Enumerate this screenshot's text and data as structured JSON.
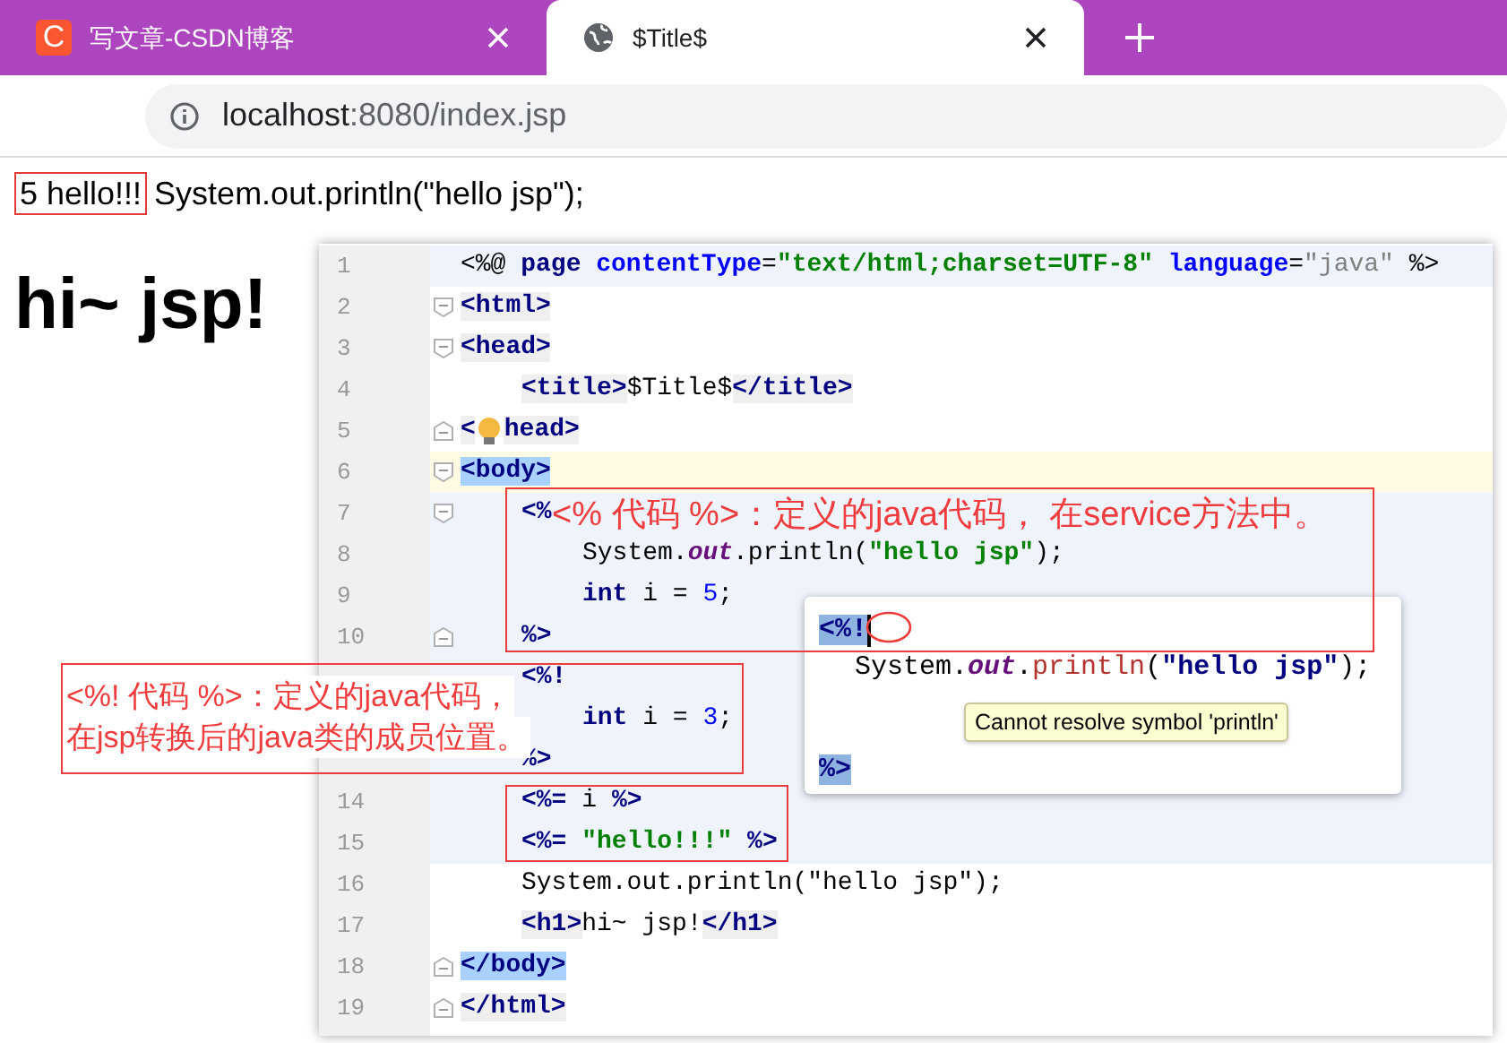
{
  "browser": {
    "tabs": [
      {
        "title": "写文章-CSDN博客",
        "logo_text": "C",
        "selected": false
      },
      {
        "title": "$Title$",
        "selected": true
      }
    ],
    "address": {
      "host": "localhost",
      "rest": ":8080/index.jsp"
    }
  },
  "page": {
    "boxed_output": "5 hello!!!",
    "output": "System.out.println(\"hello jsp\");",
    "heading": "hi~ jsp!"
  },
  "editor": {
    "lines": [
      {
        "number": "1",
        "scriptlet": true,
        "current": false,
        "indented": false,
        "nested": false,
        "fold_start": false,
        "fold_end": false,
        "tokens": [
          {
            "text": "<%@ ",
            "kind": "plain"
          },
          {
            "text": "page",
            "kind": "keyword"
          },
          {
            "text": " contentType",
            "kind": "attr"
          },
          {
            "text": "=",
            "kind": "plain"
          },
          {
            "text": "\"text/html;charset=UTF-8\"",
            "kind": "string"
          },
          {
            "text": " language",
            "kind": "attr"
          },
          {
            "text": "=",
            "kind": "plain"
          },
          {
            "text": "\"java\"",
            "kind": "string_gray"
          },
          {
            "text": " %>",
            "kind": "plain"
          }
        ]
      },
      {
        "number": "2",
        "scriptlet": false,
        "current": false,
        "indented": false,
        "nested": false,
        "fold_start": true,
        "fold_end": false,
        "tokens": [
          {
            "text": "<html>",
            "kind": "tag"
          }
        ]
      },
      {
        "number": "3",
        "scriptlet": false,
        "current": false,
        "indented": false,
        "nested": false,
        "fold_start": true,
        "fold_end": false,
        "tokens": [
          {
            "text": "<head>",
            "kind": "tag"
          }
        ]
      },
      {
        "number": "4",
        "scriptlet": false,
        "current": false,
        "indented": true,
        "nested": false,
        "fold_start": false,
        "fold_end": false,
        "tokens": [
          {
            "text": "<title>",
            "kind": "tag"
          },
          {
            "text": "$Title$",
            "kind": "plain"
          },
          {
            "text": "</title>",
            "kind": "tag"
          }
        ]
      },
      {
        "number": "5",
        "scriptlet": false,
        "current": false,
        "indented": false,
        "nested": false,
        "fold_start": false,
        "fold_end": true,
        "tokens": [
          {
            "text": "<",
            "kind": "tag"
          },
          {
            "kind": "bulb"
          },
          {
            "text": "head>",
            "kind": "tag"
          }
        ]
      },
      {
        "number": "6",
        "scriptlet": false,
        "current": true,
        "indented": false,
        "nested": false,
        "fold_start": true,
        "fold_end": false,
        "tokens": [
          {
            "text": "<body>",
            "kind": "tag_match"
          }
        ]
      },
      {
        "number": "7",
        "scriptlet": true,
        "current": false,
        "indented": true,
        "nested": false,
        "fold_start": true,
        "fold_end": false,
        "tokens": [
          {
            "text": "<%",
            "kind": "delim"
          }
        ]
      },
      {
        "number": "8",
        "scriptlet": true,
        "current": false,
        "indented": true,
        "nested": true,
        "fold_start": false,
        "fold_end": false,
        "tokens": [
          {
            "text": "System.",
            "kind": "plain"
          },
          {
            "text": "out",
            "kind": "field"
          },
          {
            "text": ".println(",
            "kind": "plain"
          },
          {
            "text": "\"hello jsp\"",
            "kind": "string"
          },
          {
            "text": ");",
            "kind": "plain"
          }
        ]
      },
      {
        "number": "9",
        "scriptlet": true,
        "current": false,
        "indented": true,
        "nested": true,
        "fold_start": false,
        "fold_end": false,
        "tokens": [
          {
            "text": "int",
            "kind": "keyword"
          },
          {
            "text": " i = ",
            "kind": "plain"
          },
          {
            "text": "5",
            "kind": "number"
          },
          {
            "text": ";",
            "kind": "plain"
          }
        ]
      },
      {
        "number": "10",
        "scriptlet": true,
        "current": false,
        "indented": true,
        "nested": false,
        "fold_start": false,
        "fold_end": true,
        "tokens": [
          {
            "text": "%>",
            "kind": "delim"
          }
        ]
      },
      {
        "scriptlet": true,
        "current": false,
        "indented": true,
        "nested": false,
        "tokens": [
          {
            "text": "<%!",
            "kind": "delim"
          }
        ]
      },
      {
        "scriptlet": true,
        "current": false,
        "indented": true,
        "nested": true,
        "tokens": [
          {
            "text": "int",
            "kind": "keyword"
          },
          {
            "text": " i = ",
            "kind": "plain"
          },
          {
            "text": "3",
            "kind": "number"
          },
          {
            "text": ";",
            "kind": "plain"
          }
        ]
      },
      {
        "scriptlet": true,
        "current": false,
        "indented": true,
        "nested": false,
        "tokens": [
          {
            "text": "%>",
            "kind": "delim"
          }
        ]
      },
      {
        "number": "14",
        "scriptlet": true,
        "current": false,
        "indented": true,
        "nested": false,
        "fold_start": false,
        "fold_end": false,
        "tokens": [
          {
            "text": "<%=",
            "kind": "delim"
          },
          {
            "text": " i ",
            "kind": "plain"
          },
          {
            "text": "%>",
            "kind": "delim"
          }
        ]
      },
      {
        "number": "15",
        "scriptlet": true,
        "current": false,
        "indented": true,
        "nested": false,
        "fold_start": false,
        "fold_end": false,
        "tokens": [
          {
            "text": "<%=",
            "kind": "delim"
          },
          {
            "text": " \"hello!!!\"",
            "kind": "string"
          },
          {
            "text": " %>",
            "kind": "delim"
          }
        ]
      },
      {
        "number": "16",
        "scriptlet": false,
        "current": false,
        "indented": true,
        "nested": false,
        "fold_start": false,
        "fold_end": false,
        "tokens": [
          {
            "text": "System.out.println(\"hello jsp\");",
            "kind": "plain"
          }
        ]
      },
      {
        "number": "17",
        "scriptlet": false,
        "current": false,
        "indented": true,
        "nested": false,
        "fold_start": false,
        "fold_end": false,
        "tokens": [
          {
            "text": "<h1>",
            "kind": "tag"
          },
          {
            "text": "hi~ jsp!",
            "kind": "plain"
          },
          {
            "text": "</h1>",
            "kind": "tag"
          }
        ]
      },
      {
        "number": "18",
        "scriptlet": false,
        "current": false,
        "indented": false,
        "nested": false,
        "fold_start": false,
        "fold_end": true,
        "tokens": [
          {
            "text": "</body>",
            "kind": "tag_match"
          }
        ]
      },
      {
        "number": "19",
        "scriptlet": false,
        "current": false,
        "indented": false,
        "nested": false,
        "fold_start": false,
        "fold_end": true,
        "tokens": [
          {
            "text": "</html>",
            "kind": "tag"
          }
        ]
      }
    ]
  },
  "popup": {
    "lines": [
      {
        "tokens": [
          {
            "text": "<%!",
            "kind": "sel"
          }
        ]
      },
      {
        "tokens": [
          {
            "text": "System.",
            "kind": "plain"
          },
          {
            "text": "out",
            "kind": "field"
          },
          {
            "text": ".",
            "kind": "plain"
          },
          {
            "text": "println",
            "kind": "error"
          },
          {
            "text": "(",
            "kind": "plain"
          },
          {
            "text": "\"hello jsp\"",
            "kind": "string_dark"
          },
          {
            "text": ");",
            "kind": "plain"
          }
        ]
      },
      {
        "tokens": [
          {
            "text": "%>",
            "kind": "sel"
          }
        ]
      }
    ],
    "tooltip": "Cannot resolve symbol 'println'"
  },
  "annotations": [
    {
      "lines": [
        "<% 代码 %>：定义的java代码， 在service方法中。"
      ]
    },
    {
      "lines": [
        "<%! 代码 %>：定义的java代码，",
        "在jsp转换后的java类的成员位置。"
      ]
    }
  ]
}
